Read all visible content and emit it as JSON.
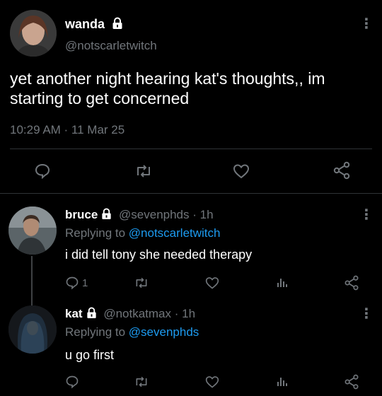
{
  "main_tweet": {
    "display_name": "wanda",
    "handle": "@notscarletwitch",
    "text": "yet another night hearing kat's thoughts,, im starting to get concerned",
    "timestamp": "10:29 AM · 11 Mar 25",
    "actions": [
      "reply-icon",
      "retweet-icon",
      "like-icon",
      "share-icon"
    ]
  },
  "replies": [
    {
      "display_name": "bruce",
      "handle": "@sevenphds",
      "time": "1h",
      "replying_prefix": "Replying to",
      "replying_to": "@notscarletwitch",
      "text": "i did tell tony she needed therapy",
      "reply_count": "1",
      "actions": [
        "reply-icon",
        "retweet-icon",
        "like-icon",
        "views-icon",
        "share-icon"
      ]
    },
    {
      "display_name": "kat",
      "handle": "@notkatmax",
      "time": "1h",
      "replying_prefix": "Replying to",
      "replying_to": "@sevenphds",
      "text": "u go first",
      "reply_count": "",
      "actions": [
        "reply-icon",
        "retweet-icon",
        "like-icon",
        "views-icon",
        "share-icon"
      ]
    }
  ],
  "colors": {
    "background": "#000000",
    "text": "#e7e9ea",
    "muted": "#71767b",
    "link": "#1d9bf0",
    "divider": "#2f3336"
  }
}
